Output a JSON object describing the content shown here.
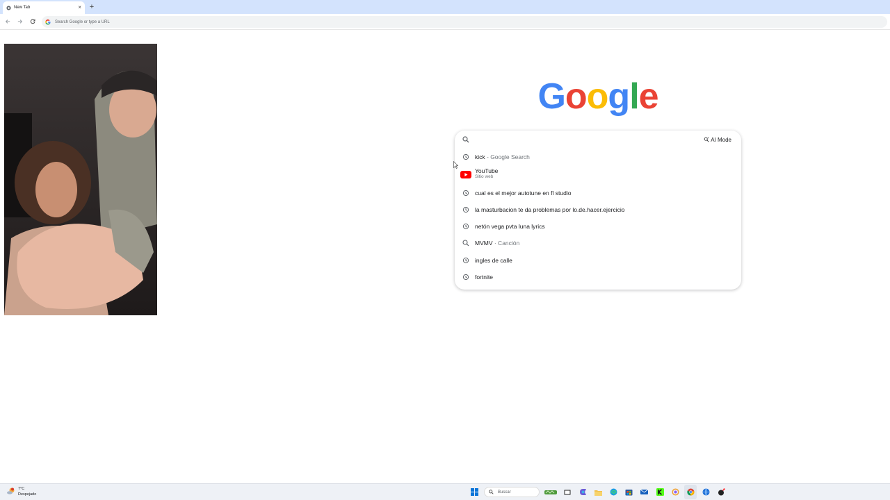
{
  "browser": {
    "tab": {
      "title": "New Tab",
      "close_glyph": "×"
    },
    "new_tab_glyph": "+",
    "omnibox": {
      "placeholder": "Search Google or type a URL"
    }
  },
  "search": {
    "ai_mode_label": "AI Mode",
    "suggestions": [
      {
        "icon": "history-icon",
        "text": "kick",
        "sub": " - Google Search"
      },
      {
        "icon": "youtube-icon",
        "text": "YouTube",
        "sub": "Sitio web"
      },
      {
        "icon": "history-icon",
        "text": "cual es el mejor autotune en fl studio",
        "sub": ""
      },
      {
        "icon": "history-icon",
        "text": "la masturbacion te da problemas por lo.de.hacer.ejercicio",
        "sub": ""
      },
      {
        "icon": "history-icon",
        "text": "netón vega pvta luna lyrics",
        "sub": ""
      },
      {
        "icon": "search-icon",
        "text": "MVMV",
        "sub": " · Canción"
      },
      {
        "icon": "history-icon",
        "text": "ingles de calle",
        "sub": ""
      },
      {
        "icon": "history-icon",
        "text": "fortnite",
        "sub": ""
      }
    ]
  },
  "taskbar": {
    "weather": {
      "temp": "7°C",
      "condition": "Despejado"
    },
    "search_placeholder": "Buscar"
  },
  "colors": {
    "google_blue": "#4285F4",
    "google_red": "#EA4335",
    "google_yellow": "#FBBC05",
    "google_green": "#34A853",
    "youtube_red": "#FF0000",
    "tabstrip_bg": "#d3e3fd"
  }
}
